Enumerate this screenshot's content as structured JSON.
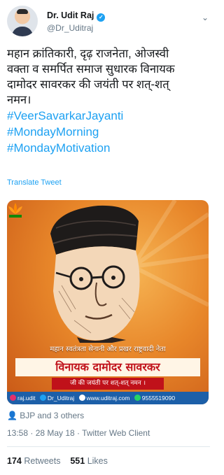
{
  "author": {
    "name": "Dr. Udit Raj",
    "handle": "@Dr_Uditraj"
  },
  "tweet": {
    "lines": [
      "महान क्रांतिकारी, दृढ़ राजनेता, ओजस्वी",
      "वक्ता व समर्पित समाज सुधारक विनायक",
      "दामोदर सावरकर की जयंती पर शत्-शत्",
      "नमन।"
    ],
    "hashtags": [
      "#VeerSavarkarJayanti",
      "#MondayMorning",
      "#MondayMotivation"
    ],
    "translate": "Translate Tweet"
  },
  "media": {
    "line1": "महान स्वतंत्रता सेनानी और प्रखर राष्ट्रवादी नेता",
    "banner": "विनायक दामोदर सावरकर",
    "subline": "जी की जयंती पर शत्-शत् नमन ।",
    "footer_items": [
      "raj.udit",
      "Dr_Uditraj",
      "www.uditraj.com",
      "9555519090"
    ],
    "footer_colors": [
      "#e1306c",
      "#1da1f2",
      "#ffffff",
      "#25d366"
    ]
  },
  "liked_by": "BJP and 3 others",
  "meta": "13:58 · 28 May 18 · Twitter Web Client",
  "stats": {
    "retweets_count": "174",
    "retweets_label": "Retweets",
    "likes_count": "551",
    "likes_label": "Likes"
  },
  "colors": {
    "link": "#1da1f2",
    "muted": "#657786",
    "banner_red": "#c0111a"
  }
}
